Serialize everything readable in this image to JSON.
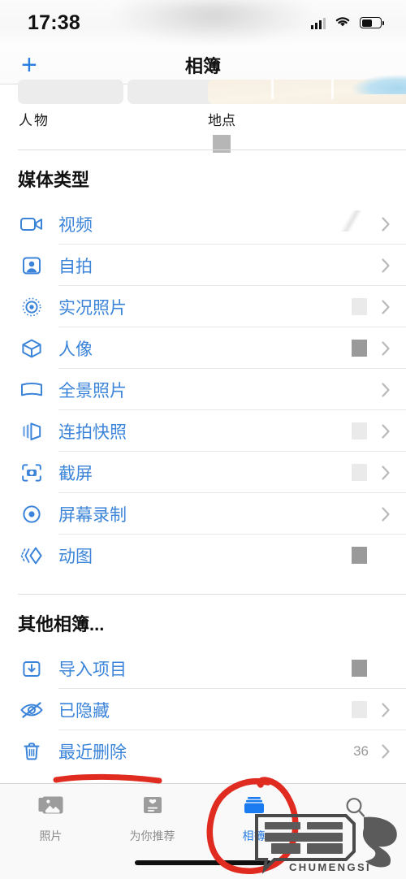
{
  "status_bar": {
    "time": "17:38",
    "signal_icon": "cellular-signal-icon",
    "wifi_icon": "wifi-icon",
    "battery_icon": "battery-icon",
    "battery_level_pct": 55
  },
  "nav": {
    "title": "相簿",
    "add_label": "+"
  },
  "top_albums": [
    {
      "label": "人物",
      "thumb": "grey-placeholder"
    },
    {
      "label": "地点",
      "thumb": "map-thumbnail"
    }
  ],
  "sections": [
    {
      "title": "媒体类型",
      "rows": [
        {
          "label": "视频",
          "icon": "video-camera-icon",
          "count": "",
          "placeholder": "none",
          "chevron": true,
          "smudge": true
        },
        {
          "label": "自拍",
          "icon": "selfie-person-icon",
          "count": "",
          "placeholder": "none",
          "chevron": true,
          "smudge": false
        },
        {
          "label": "实况照片",
          "icon": "live-photo-icon",
          "count": "",
          "placeholder": "light",
          "chevron": true,
          "smudge": false
        },
        {
          "label": "人像",
          "icon": "cube-portrait-icon",
          "count": "",
          "placeholder": "dark",
          "chevron": true,
          "smudge": false
        },
        {
          "label": "全景照片",
          "icon": "panorama-icon",
          "count": "",
          "placeholder": "none",
          "chevron": true,
          "smudge": false
        },
        {
          "label": "连拍快照",
          "icon": "burst-stack-icon",
          "count": "",
          "placeholder": "light",
          "chevron": true,
          "smudge": false
        },
        {
          "label": "截屏",
          "icon": "screenshot-icon",
          "count": "",
          "placeholder": "light",
          "chevron": true,
          "smudge": false
        },
        {
          "label": "屏幕录制",
          "icon": "screen-record-icon",
          "count": "",
          "placeholder": "none",
          "chevron": true,
          "smudge": false
        },
        {
          "label": "动图",
          "icon": "animated-gif-icon",
          "count": "",
          "placeholder": "dark",
          "chevron": false,
          "smudge": false
        }
      ]
    },
    {
      "title": "其他相簿...",
      "rows": [
        {
          "label": "导入项目",
          "icon": "import-tray-icon",
          "count": "",
          "placeholder": "dark",
          "chevron": false,
          "smudge": false
        },
        {
          "label": "已隐藏",
          "icon": "eye-slash-icon",
          "count": "",
          "placeholder": "light",
          "chevron": true,
          "smudge": false
        },
        {
          "label": "最近删除",
          "icon": "trash-icon",
          "count": "36",
          "placeholder": "none",
          "chevron": true,
          "smudge": false
        }
      ]
    }
  ],
  "tabbar": {
    "tabs": [
      {
        "label": "照片",
        "icon": "photos-stack-icon",
        "active": false
      },
      {
        "label": "为你推荐",
        "icon": "for-you-card-icon",
        "active": false
      },
      {
        "label": "相簿",
        "icon": "albums-folder-icon",
        "active": true
      },
      {
        "label": "",
        "icon": "search-icon",
        "active": false
      }
    ]
  },
  "annotations": {
    "color": "#e02b20",
    "underline_target": "最近删除",
    "circle_target": "相簿"
  },
  "watermark": {
    "text": "CHUMENGSI"
  },
  "colors": {
    "accent_blue": "#3b84d9",
    "nav_blue": "#2b7fe0",
    "annotation_red": "#e02b20",
    "text_primary": "#111111",
    "text_muted": "#9a9a9a"
  }
}
